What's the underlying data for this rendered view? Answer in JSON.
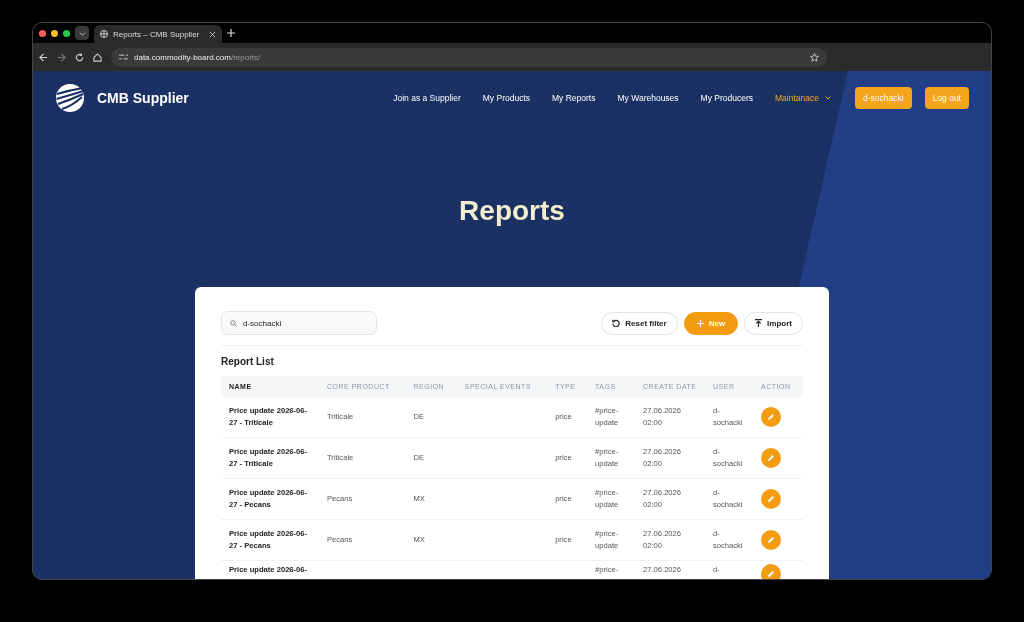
{
  "browser": {
    "tab_title": "Reports – CMB Supplier",
    "url_host": "data.commodity-board.com",
    "url_path": "/reports/"
  },
  "site": {
    "brand": "CMB Supplier",
    "nav": [
      {
        "label": "Join as a Supplier",
        "selected": false,
        "kind": "link"
      },
      {
        "label": "My Products",
        "selected": false,
        "kind": "link"
      },
      {
        "label": "My Reports",
        "selected": false,
        "kind": "link"
      },
      {
        "label": "My Warehouses",
        "selected": false,
        "kind": "link"
      },
      {
        "label": "My Producers",
        "selected": false,
        "kind": "link"
      },
      {
        "label": "Maintanace",
        "selected": true,
        "kind": "dropdown"
      }
    ],
    "user_button": "d-sochacki",
    "logout_button": "Log out"
  },
  "page_title": "Reports",
  "search": {
    "value": "d-sochacki"
  },
  "actions": [
    {
      "label": "Reset filter",
      "kind": "reset"
    },
    {
      "label": "New",
      "kind": "new"
    },
    {
      "label": "Import",
      "kind": "import"
    }
  ],
  "list_title": "Report List",
  "table": {
    "columns": [
      {
        "label": "NAME",
        "selected": true
      },
      {
        "label": "CORE PRODUCT",
        "selected": false
      },
      {
        "label": "REGION",
        "selected": false
      },
      {
        "label": "SPECIAL EVENTS",
        "selected": false
      },
      {
        "label": "TYPE",
        "selected": false
      },
      {
        "label": "TAGS",
        "selected": false
      },
      {
        "label": "CREATE DATE",
        "selected": false
      },
      {
        "label": "USER",
        "selected": false
      },
      {
        "label": "ACTION",
        "selected": false
      }
    ],
    "rows": [
      {
        "name": "Price update 2026-06-27 - Triticale",
        "core_product": "Triticale",
        "region": "DE",
        "type": "price",
        "tags": "#price-update",
        "create_date": "27.06.2026 02:00",
        "user": "d-sochacki"
      },
      {
        "name": "Price update 2026-06-27 - Triticale",
        "core_product": "Triticale",
        "region": "DE",
        "type": "price",
        "tags": "#price-update",
        "create_date": "27.06.2026 02:00",
        "user": "d-sochacki"
      },
      {
        "name": "Price update 2026-06-27 - Pecans",
        "core_product": "Pecans",
        "region": "MX",
        "type": "price",
        "tags": "#price-update",
        "create_date": "27.06.2026 02:00",
        "user": "d-sochacki"
      },
      {
        "name": "Price update 2026-06-27 - Pecans",
        "core_product": "Pecans",
        "region": "MX",
        "type": "price",
        "tags": "#price-update",
        "create_date": "27.06.2026 02:00",
        "user": "d-sochacki"
      },
      {
        "name": "Price update 2026-06-",
        "tags": "#price-",
        "create_date": "27.06.2026",
        "user": "d-"
      }
    ]
  }
}
